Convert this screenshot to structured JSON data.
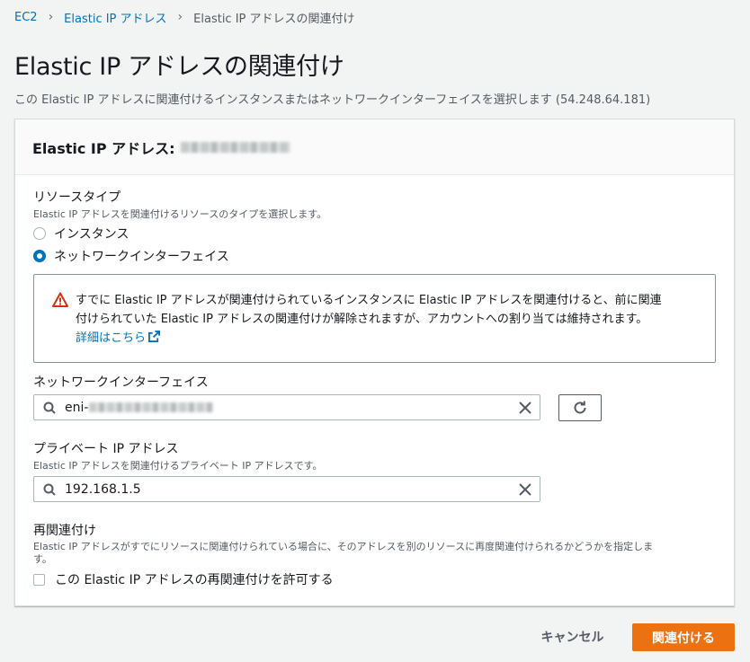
{
  "breadcrumb": {
    "items": [
      "EC2",
      "Elastic IP アドレス",
      "Elastic IP アドレスの関連付け"
    ]
  },
  "page": {
    "title": "Elastic IP アドレスの関連付け",
    "description": "この Elastic IP アドレスに関連付けるインスタンスまたはネットワークインターフェイスを選択します (54.248.64.181)"
  },
  "panel": {
    "header_label": "Elastic IP アドレス:"
  },
  "resource_type": {
    "label": "リソースタイプ",
    "description": "Elastic IP アドレスを関連付けるリソースのタイプを選択します。",
    "options": [
      "インスタンス",
      "ネットワークインターフェイス"
    ],
    "selected": "ネットワークインターフェイス"
  },
  "alert": {
    "line1": "すでに Elastic IP アドレスが関連付けられているインスタンスに Elastic IP アドレスを関連付けると、前に関連",
    "line2": "付けられていた Elastic IP アドレスの関連付けが解除されますが、アカウントへの割り当ては維持されます。",
    "link": "詳細はこちら"
  },
  "network_interface": {
    "label": "ネットワークインターフェイス",
    "value_prefix": "eni-"
  },
  "private_ip": {
    "label": "プライベート IP アドレス",
    "description": "Elastic IP アドレスを関連付けるプライベート IP アドレスです。",
    "value": "192.168.1.5"
  },
  "reassociation": {
    "label": "再関連付け",
    "description_line1": "Elastic IP アドレスがすでにリソースに関連付けられている場合に、そのアドレスを別のリソースに再度関連付けられるかどうかを指定しま",
    "description_line2": "す。",
    "checkbox_label": "この Elastic IP アドレスの再関連付けを許可する"
  },
  "actions": {
    "cancel": "キャンセル",
    "submit": "関連付ける"
  },
  "colors": {
    "link": "#0073bb",
    "primary": "#ec7211",
    "warning": "#d13212"
  }
}
